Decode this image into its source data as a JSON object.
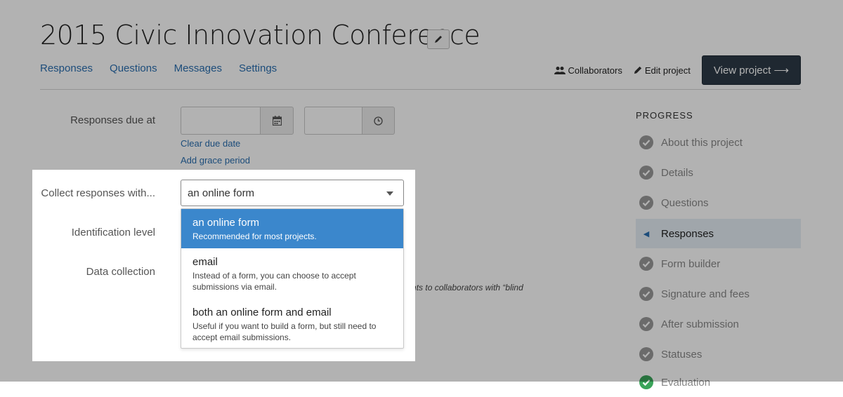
{
  "header": {
    "title": "2015 Civic Innovation Conference",
    "nav": [
      "Responses",
      "Questions",
      "Messages",
      "Settings"
    ],
    "collaborators": "Collaborators",
    "edit_project": "Edit project",
    "view_project": "View project ⟶"
  },
  "form": {
    "due_label": "Responses due at",
    "clear_due": "Clear due date",
    "grace": "Add grace period",
    "collect_label": "Collect responses with...",
    "id_label": "Identification level",
    "data_label": "Data collection",
    "obscured_text": "ndents to collaborators with “blind"
  },
  "dropdown": {
    "selected": "an online form",
    "options": [
      {
        "title": "an online form",
        "desc": "Recommended for most projects."
      },
      {
        "title": "email",
        "desc": "Instead of a form, you can choose to accept submissions via email."
      },
      {
        "title": "both an online form and email",
        "desc": "Useful if you want to build a form, but still need to accept email submissions."
      }
    ]
  },
  "progress": {
    "title": "PROGRESS",
    "items": [
      "About this project",
      "Details",
      "Questions",
      "Responses",
      "Form builder",
      "Signature and fees",
      "After submission",
      "Statuses",
      "Evaluation"
    ]
  },
  "colors": {
    "link": "#2a6fb0",
    "primary_button": "#2d3a47",
    "selected_option": "#3b87cc",
    "check": "#9a9a9a",
    "active_step": "#e6eef5"
  }
}
